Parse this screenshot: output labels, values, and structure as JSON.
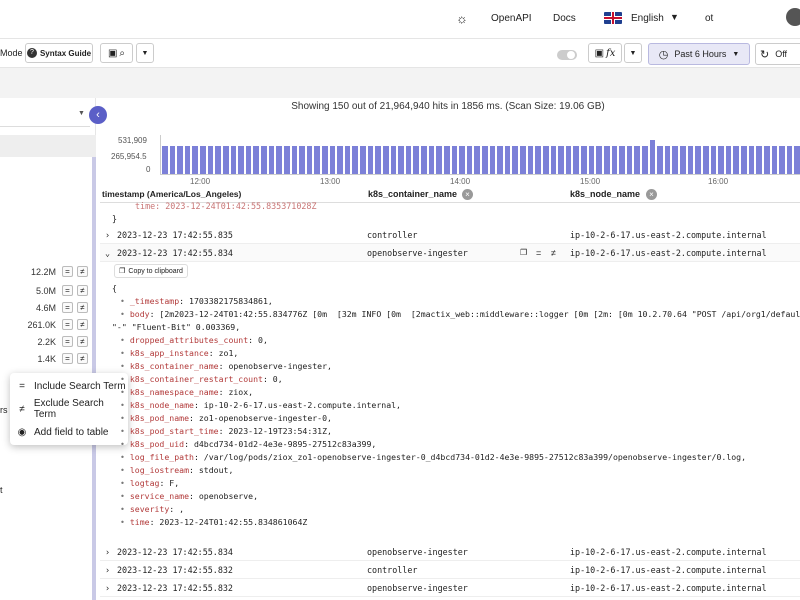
{
  "nav": {
    "openapi": "OpenAPI",
    "docs": "Docs",
    "language": "English",
    "org": "ot"
  },
  "toolbar": {
    "mode_label": "Mode",
    "syntax_guide": "Syntax Guide",
    "time_range": "Past 6 Hours",
    "refresh": "Off"
  },
  "search_summary": "Showing 150 out of 21,964,940 hits in 1856 ms. (Scan Size: 19.06 GB)",
  "histogram": {
    "y_labels": [
      "531,909",
      "265,954.5",
      "0"
    ],
    "x_labels": [
      "12:00",
      "13:00",
      "14:00",
      "15:00",
      "16:00"
    ]
  },
  "chart_data": {
    "type": "bar",
    "ylim": [
      0,
      531909
    ],
    "x_ticks": [
      "12:00",
      "13:00",
      "14:00",
      "15:00",
      "16:00"
    ],
    "values": [
      440000,
      440000,
      440000,
      440000,
      440000,
      440000,
      440000,
      440000,
      440000,
      440000,
      440000,
      440000,
      440000,
      440000,
      440000,
      440000,
      440000,
      440000,
      440000,
      440000,
      440000,
      440000,
      440000,
      440000,
      440000,
      440000,
      440000,
      440000,
      440000,
      440000,
      440000,
      440000,
      440000,
      440000,
      440000,
      440000,
      440000,
      440000,
      440000,
      440000,
      440000,
      440000,
      440000,
      440000,
      440000,
      440000,
      440000,
      440000,
      440000,
      440000,
      440000,
      440000,
      440000,
      440000,
      440000,
      440000,
      440000,
      440000,
      440000,
      440000,
      440000,
      440000,
      440000,
      440000,
      531909,
      440000,
      440000,
      440000,
      440000,
      440000,
      440000,
      440000,
      440000,
      440000,
      440000,
      440000,
      440000,
      440000,
      440000,
      440000,
      440000,
      440000,
      440000,
      440000
    ]
  },
  "table": {
    "headers": [
      "timestamp (America/Los_Angeles)",
      "k8s_container_name",
      "k8s_node_name"
    ],
    "partial_line": "time: 2023-12-24T01:42:55.835371028Z",
    "closing_brace": "}",
    "rows_top": [
      {
        "ts": "2023-12-23 17:42:55.835",
        "container": "controller",
        "node": "ip-10-2-6-17.us-east-2.compute.internal"
      },
      {
        "ts": "2023-12-23 17:42:55.834",
        "container": "openobserve-ingester",
        "node": "ip-10-2-6-17.us-east-2.compute.internal"
      }
    ],
    "rows_bottom": [
      {
        "ts": "2023-12-23 17:42:55.834",
        "container": "openobserve-ingester",
        "node": "ip-10-2-6-17.us-east-2.compute.internal"
      },
      {
        "ts": "2023-12-23 17:42:55.832",
        "container": "controller",
        "node": "ip-10-2-6-17.us-east-2.compute.internal"
      },
      {
        "ts": "2023-12-23 17:42:55.832",
        "container": "openobserve-ingester",
        "node": "ip-10-2-6-17.us-east-2.compute.internal"
      }
    ],
    "copy_label": "Copy to clipboard"
  },
  "json_lines": [
    {
      "k": "",
      "v": "{"
    },
    {
      "k": "_timestamp",
      "v": ": 1703382175834861,"
    },
    {
      "k": "body",
      "v": ": [2m2023-12-24T01:42:55.834776Z [0m  [32m INFO [0m  [2mactix_web::middleware::logger [0m [2m: [0m 10.2.70.64 \"POST /api/org1/defaul"
    },
    {
      "k": "",
      "v": "\"-\" \"Fluent-Bit\" 0.003369,"
    },
    {
      "k": "dropped_attributes_count",
      "v": ": 0,"
    },
    {
      "k": "k8s_app_instance",
      "v": ": zo1,"
    },
    {
      "k": "k8s_container_name",
      "v": ": openobserve-ingester,"
    },
    {
      "k": "k8s_container_restart_count",
      "v": ": 0,"
    },
    {
      "k": "k8s_namespace_name",
      "v": ": ziox,"
    },
    {
      "k": "k8s_node_name",
      "v": ": ip-10-2-6-17.us-east-2.compute.internal,"
    },
    {
      "k": "k8s_pod_name",
      "v": ": zo1-openobserve-ingester-0,"
    },
    {
      "k": "k8s_pod_start_time",
      "v": ": 2023-12-19T23:54:31Z,"
    },
    {
      "k": "k8s_pod_uid",
      "v": ": d4bcd734-01d2-4e3e-9895-27512c83a399,"
    },
    {
      "k": "log_file_path",
      "v": ": /var/log/pods/ziox_zo1-openobserve-ingester-0_d4bcd734-01d2-4e3e-9895-27512c83a399/openobserve-ingester/0.log,"
    },
    {
      "k": "log_iostream",
      "v": ": stdout,"
    },
    {
      "k": "logtag",
      "v": ": F,"
    },
    {
      "k": "service_name",
      "v": ": openobserve,"
    },
    {
      "k": "severity",
      "v": ": ,"
    },
    {
      "k": "time",
      "v": ": 2023-12-24T01:42:55.834861064Z"
    }
  ],
  "left_counts": [
    "12.2M",
    "5.0M",
    "4.6M",
    "261.0K",
    "2.2K",
    "1.4K"
  ],
  "left_truncated": [
    "rs",
    "t"
  ],
  "context_menu": [
    "Include Search Term",
    "Exclude Search Term",
    "Add field to table"
  ]
}
